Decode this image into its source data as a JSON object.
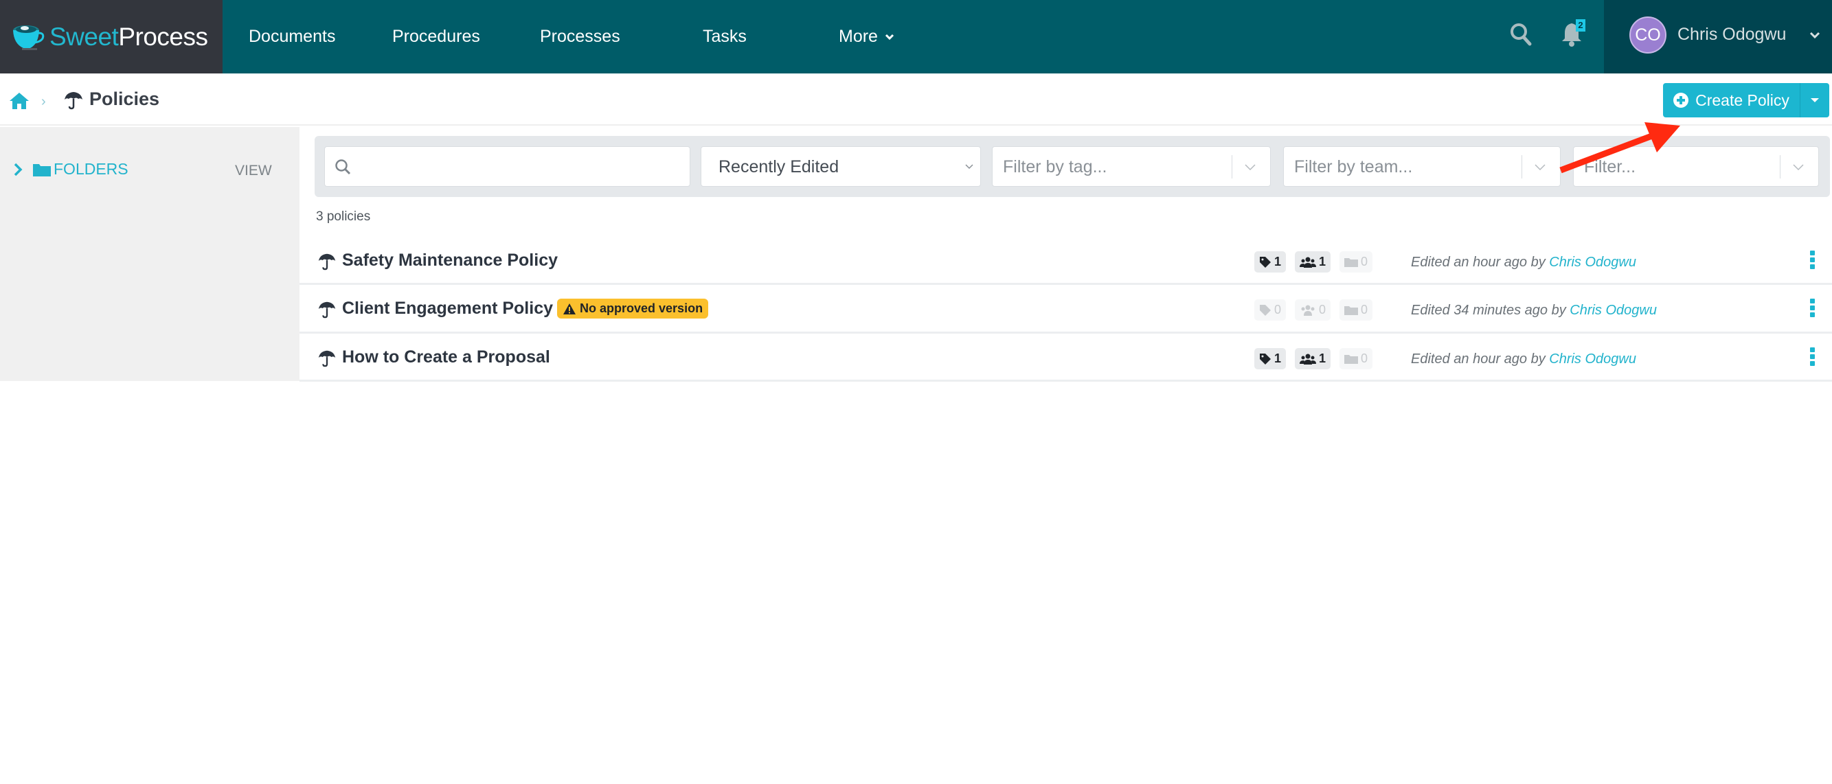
{
  "brand": {
    "part1": "Sweet",
    "part2": "Process"
  },
  "nav": [
    {
      "label": "Documents"
    },
    {
      "label": "Procedures"
    },
    {
      "label": "Processes"
    },
    {
      "label": "Tasks"
    },
    {
      "label": "More"
    }
  ],
  "header": {
    "notification_count": "2",
    "user_initials": "CO",
    "user_name": "Chris Odogwu",
    "avatar_color": "#9a7fd1"
  },
  "breadcrumb": {
    "current": "Policies"
  },
  "actions": {
    "create_label": "Create Policy"
  },
  "sidebar": {
    "folders_label": "FOLDERS",
    "view_label": "VIEW"
  },
  "filters": {
    "search_value": "",
    "search_placeholder": "",
    "sort_selected": "Recently Edited",
    "tag_placeholder": "Filter by tag...",
    "team_placeholder": "Filter by team...",
    "other_placeholder": "Filter..."
  },
  "list": {
    "count_label": "3 policies",
    "items": [
      {
        "title": "Safety Maintenance Policy",
        "badge": "",
        "tags": "1",
        "teams": "1",
        "folders": "0",
        "edited_prefix": "Edited an hour ago by",
        "edited_by": "Chris Odogwu"
      },
      {
        "title": "Client Engagement Policy",
        "badge": "No approved version",
        "tags": "0",
        "teams": "0",
        "folders": "0",
        "edited_prefix": "Edited 34 minutes ago by",
        "edited_by": "Chris Odogwu"
      },
      {
        "title": "How to Create a Proposal",
        "badge": "",
        "tags": "1",
        "teams": "1",
        "folders": "0",
        "edited_prefix": "Edited an hour ago by",
        "edited_by": "Chris Odogwu"
      }
    ]
  },
  "colors": {
    "header_bg": "#005c68",
    "brand_bg": "#33363d",
    "user_bg": "#004450",
    "accent": "#1cb6d0",
    "warning": "#fbc02d",
    "annotation_arrow": "#ff2a10"
  }
}
